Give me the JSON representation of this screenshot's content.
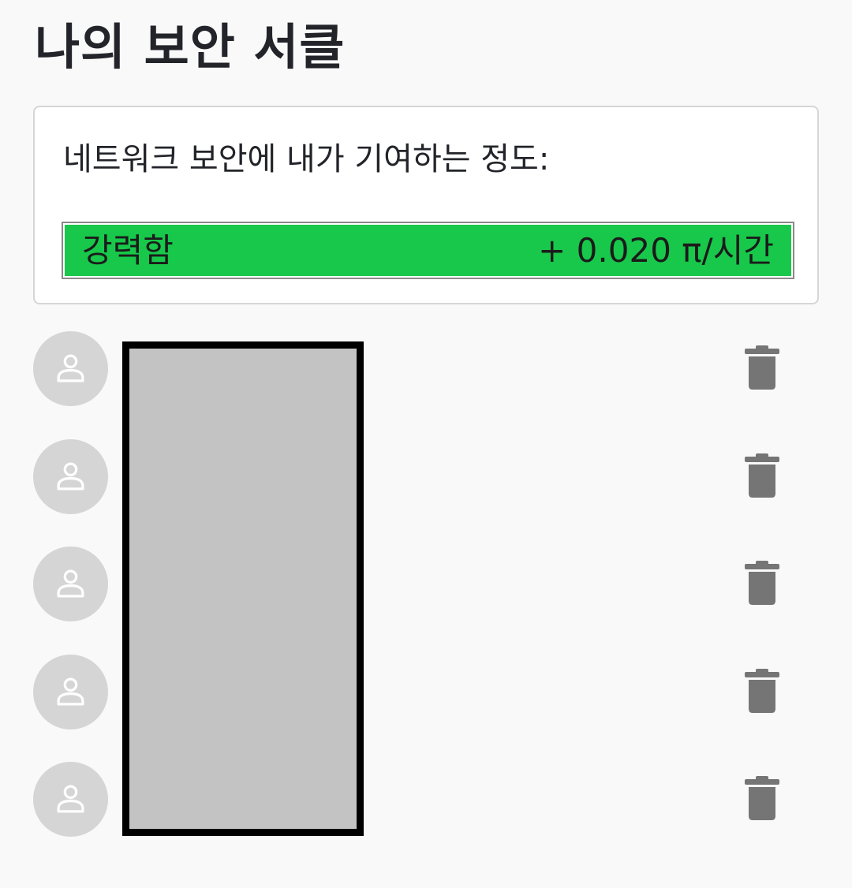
{
  "header": {
    "title": "나의 보안 서클"
  },
  "contribution": {
    "heading": "네트워크 보안에 내가 기여하는 정도:",
    "strength_label": "강력함",
    "rate": "+ 0.020 π/시간",
    "level_fraction": 1.0,
    "bar_color": "#18c84a"
  },
  "members": [
    {
      "avatar_icon": "person-icon",
      "delete_icon": "trash-icon"
    },
    {
      "avatar_icon": "person-icon",
      "delete_icon": "trash-icon"
    },
    {
      "avatar_icon": "person-icon",
      "delete_icon": "trash-icon"
    },
    {
      "avatar_icon": "person-icon",
      "delete_icon": "trash-icon"
    },
    {
      "avatar_icon": "person-icon",
      "delete_icon": "trash-icon"
    }
  ]
}
